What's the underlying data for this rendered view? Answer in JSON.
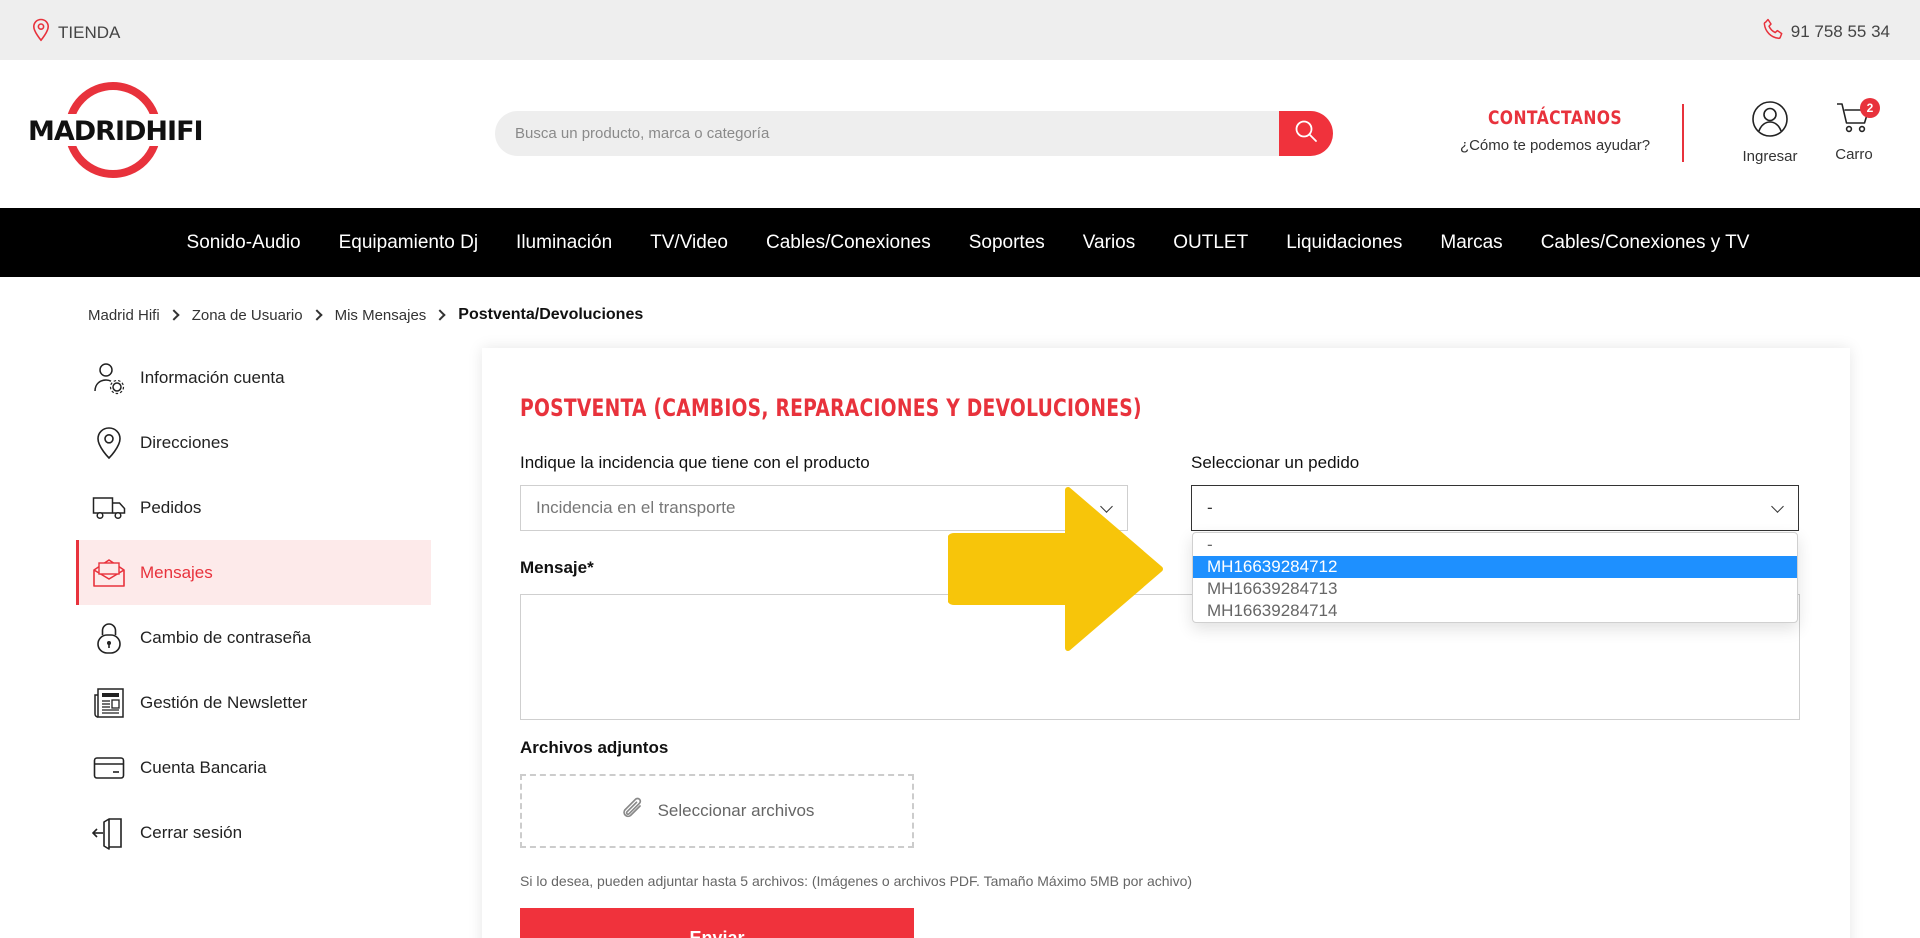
{
  "topbar": {
    "store_label": "TIENDA",
    "phone": "91 758 55 34"
  },
  "header": {
    "logo_text": "MADRIDHIFI",
    "search_placeholder": "Busca un producto, marca o categoría",
    "contact_title": "CONTÁCTANOS",
    "contact_subtitle": "¿Cómo te podemos ayudar?",
    "login_label": "Ingresar",
    "cart_label": "Carro",
    "cart_count": "2"
  },
  "nav": {
    "items": [
      "Sonido-Audio",
      "Equipamiento Dj",
      "Iluminación",
      "TV/Video",
      "Cables/Conexiones",
      "Soportes",
      "Varios",
      "OUTLET",
      "Liquidaciones",
      "Marcas",
      "Cables/Conexiones y TV"
    ]
  },
  "breadcrumb": {
    "items": [
      "Madrid Hifi",
      "Zona de Usuario",
      "Mis Mensajes"
    ],
    "current": "Postventa/Devoluciones"
  },
  "sidebar": {
    "items": [
      {
        "label": "Información cuenta",
        "icon": "user-gear-icon"
      },
      {
        "label": "Direcciones",
        "icon": "location-pin-icon"
      },
      {
        "label": "Pedidos",
        "icon": "truck-icon"
      },
      {
        "label": "Mensajes",
        "icon": "envelope-open-icon"
      },
      {
        "label": "Cambio de contraseña",
        "icon": "lock-icon"
      },
      {
        "label": "Gestión de Newsletter",
        "icon": "newspaper-icon"
      },
      {
        "label": "Cuenta Bancaria",
        "icon": "credit-card-icon"
      },
      {
        "label": "Cerrar sesión",
        "icon": "logout-icon"
      }
    ],
    "active_index": 3
  },
  "form": {
    "title": "POSTVENTA (CAMBIOS, REPARACIONES Y DEVOLUCIONES)",
    "incidence_label": "Indique la incidencia que tiene con el producto",
    "incidence_value": "Incidencia en el transporte",
    "order_label": "Seleccionar un pedido",
    "order_value": "-",
    "order_options": [
      "-",
      "MH16639284712",
      "MH16639284713",
      "MH16639284714"
    ],
    "order_highlighted": "MH16639284712",
    "message_label": "Mensaje*",
    "attachments_label": "Archivos adjuntos",
    "select_files_label": "Seleccionar archivos",
    "hint": "Si lo desea, pueden adjuntar hasta 5 archivos: (Imágenes o archivos PDF. Tamaño Máximo 5MB por achivo)",
    "submit_label": "Enviar"
  },
  "colors": {
    "brand_red": "#e8323c",
    "nav_bg": "#000000",
    "highlight_blue": "#1e90ff",
    "arrow_yellow": "#f7c50a"
  }
}
